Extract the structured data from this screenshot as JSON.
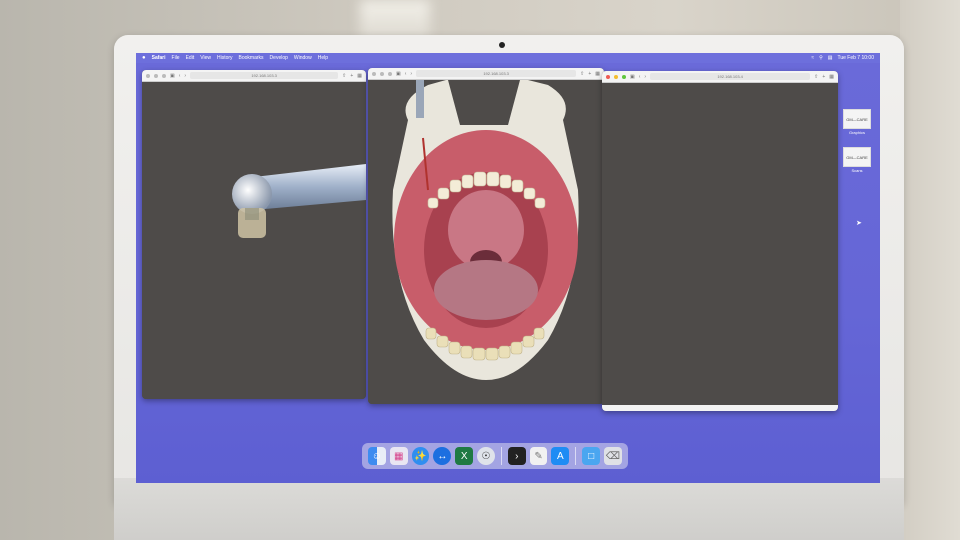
{
  "menubar": {
    "apple": "",
    "app": "Safari",
    "items": [
      "File",
      "Edit",
      "View",
      "History",
      "Bookmarks",
      "Develop",
      "Window",
      "Help"
    ],
    "datetime": "Tue Feb 7  10:00"
  },
  "windows": [
    {
      "url": "192.168.103.3",
      "name": "left"
    },
    {
      "url": "192.168.103.3",
      "name": "middle"
    },
    {
      "url": "192.168.103.4",
      "name": "right"
    }
  ],
  "desktop": {
    "icons": [
      {
        "thumb": "GM—CARE",
        "label": "Graphics"
      },
      {
        "thumb": "GM—CARE",
        "label": "Scans"
      }
    ]
  },
  "dock": {
    "items": [
      "finder-icon",
      "launchpad-icon",
      "safari-icon",
      "teamviewer-icon",
      "excel-icon",
      "3d-app-icon",
      "terminal-icon",
      "notes-icon",
      "app-store-icon",
      "folder-icon",
      "trash-icon"
    ]
  },
  "colors": {
    "desktop": "#6566d6",
    "viewer_bg": "#4e4b49",
    "gum": "#c85d6a",
    "bone": "#e9e6dc"
  }
}
